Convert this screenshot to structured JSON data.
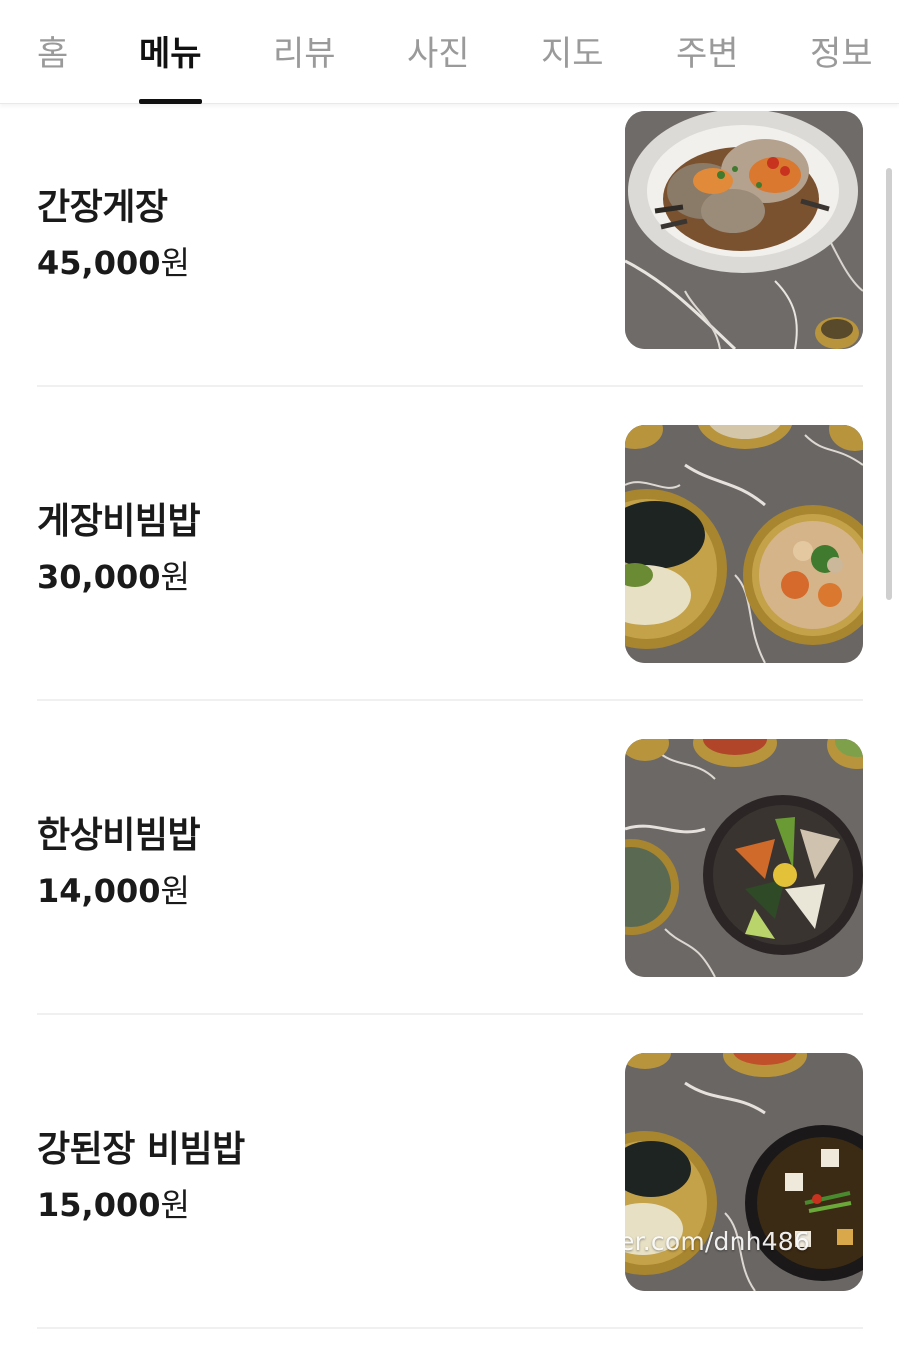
{
  "tabs": [
    {
      "label": "홈",
      "active": false
    },
    {
      "label": "메뉴",
      "active": true
    },
    {
      "label": "리뷰",
      "active": false
    },
    {
      "label": "사진",
      "active": false
    },
    {
      "label": "지도",
      "active": false
    },
    {
      "label": "주변",
      "active": false
    },
    {
      "label": "정보",
      "active": false
    }
  ],
  "menu": {
    "items": [
      {
        "name": "간장게장",
        "price": "45,000",
        "unit": "원",
        "photo": "marinated-crab-photo"
      },
      {
        "name": "게장비빔밥",
        "price": "30,000",
        "unit": "원",
        "photo": "crab-bibimbap-photo"
      },
      {
        "name": "한상비빔밥",
        "price": "14,000",
        "unit": "원",
        "photo": "table-bibimbap-photo"
      },
      {
        "name": "강된장 비빔밥",
        "price": "15,000",
        "unit": "원",
        "photo": "doenjang-bibimbap-photo"
      }
    ],
    "watermark": "er.com/dnh486"
  },
  "colors": {
    "active_tab": "#111111",
    "inactive_tab": "#9a9a9a",
    "divider": "#f0f0f0",
    "marble": "#6e6a68",
    "brass": "#b8943c"
  }
}
